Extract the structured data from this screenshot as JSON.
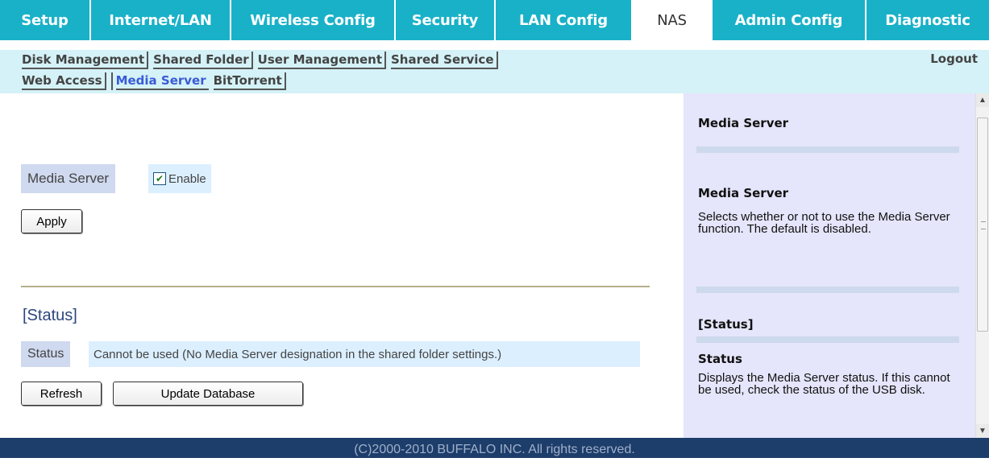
{
  "top_tabs": [
    {
      "label": "Setup",
      "active": false
    },
    {
      "label": "Internet/LAN",
      "active": false
    },
    {
      "label": "Wireless Config",
      "active": false
    },
    {
      "label": "Security",
      "active": false
    },
    {
      "label": "LAN Config",
      "active": false
    },
    {
      "label": "NAS",
      "active": true
    },
    {
      "label": "Admin Config",
      "active": false
    },
    {
      "label": "Diagnostic",
      "active": false
    }
  ],
  "sub_nav": {
    "row1": [
      "Disk Management",
      "Shared Folder",
      "User Management",
      "Shared Service"
    ],
    "row2": [
      "Web Access",
      "Media Server",
      "BitTorrent"
    ],
    "active": "Media Server",
    "logout": "Logout"
  },
  "media_server": {
    "label": "Media Server",
    "checkbox_checked": true,
    "checkbox_label": "Enable",
    "apply_button": "Apply"
  },
  "status_section": {
    "heading": "[Status]",
    "label": "Status",
    "value": "Cannot be used (No Media Server designation in the shared folder settings.)",
    "refresh_button": "Refresh",
    "update_button": "Update Database"
  },
  "help": {
    "title": "Media Server",
    "item1_title": "Media Server",
    "item1_text": "Selects whether or not to use the Media Server function. The default is disabled.",
    "section_title": "[Status]",
    "item2_title": "Status",
    "item2_text": "Displays the Media Server status. If this cannot be used, check the status of the USB disk."
  },
  "footer": "(C)2000-2010 BUFFALO INC. All rights reserved.",
  "colors": {
    "tab_bg": "#19b1c8",
    "subnav_bg": "#d4f2f7",
    "help_bg": "#e5e5fb",
    "footer_bg": "#1d3d6b",
    "active_link": "#3a5bd6"
  }
}
